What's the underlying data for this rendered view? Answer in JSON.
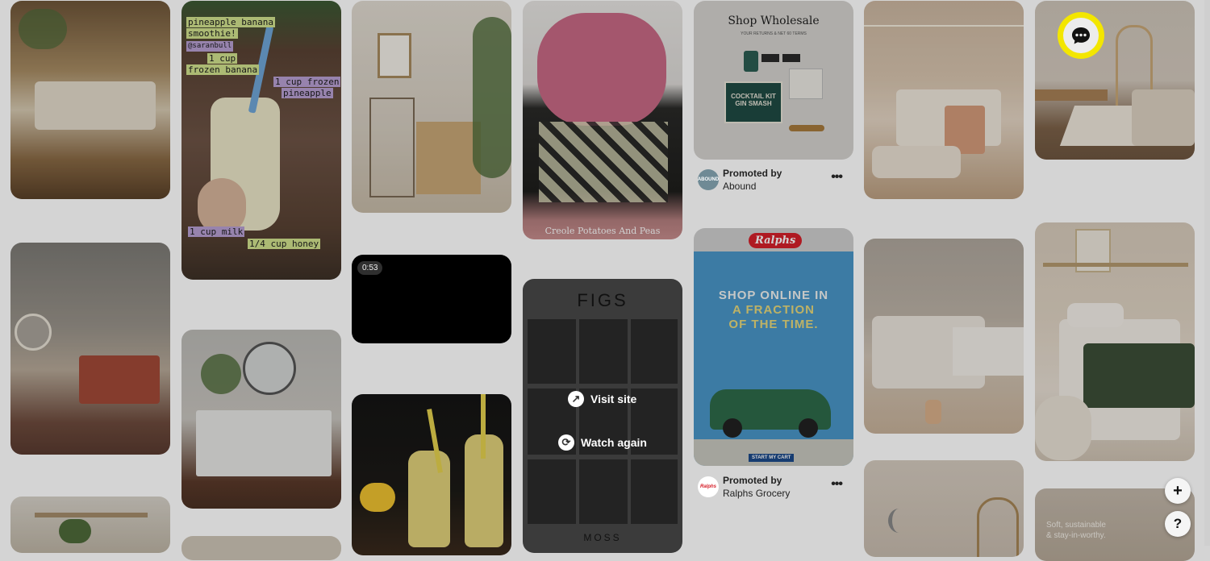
{
  "pins": {
    "smoothie": {
      "lines": [
        "pineapple banana",
        "smoothie!",
        "@saranbull",
        "1 cup",
        "frozen banana",
        "1 cup frozen",
        "pineapple",
        "1 cup milk",
        "1/4 cup honey"
      ]
    },
    "video": {
      "duration": "0:53"
    },
    "potatoes": {
      "caption": "Creole Potatoes And Peas"
    },
    "wholesale": {
      "title": "Shop Wholesale",
      "subtitle": "YOUR RETURNS & NET 60 TERMS",
      "kit_line1": "COCKTAIL KIT",
      "kit_line2": "GIN SMASH",
      "promo_label": "Promoted by",
      "promo_name": "Abound",
      "avatar_text": "ABOUND",
      "more": "•••"
    },
    "figs": {
      "brand": "FIGS",
      "visit": "Visit site",
      "watch": "Watch again",
      "footer": "MOSS"
    },
    "ralphs": {
      "logo": "Ralphs",
      "line1": "SHOP ONLINE IN",
      "line2": "A FRACTION",
      "line3": "OF THE TIME.",
      "cta": "START MY CART",
      "promo_label": "Promoted by",
      "promo_name": "Ralphs Grocery",
      "avatar_text": "Ralphs",
      "more": "•••"
    },
    "sustainable": {
      "text1": "Soft, sustainable",
      "text2": "& stay-in-worthy."
    }
  },
  "fab": {
    "plus": "+",
    "help": "?"
  },
  "colors": {
    "highlight": "#f3e600",
    "ralphs_blue": "#4a97c9",
    "ralphs_red": "#d6202a"
  }
}
